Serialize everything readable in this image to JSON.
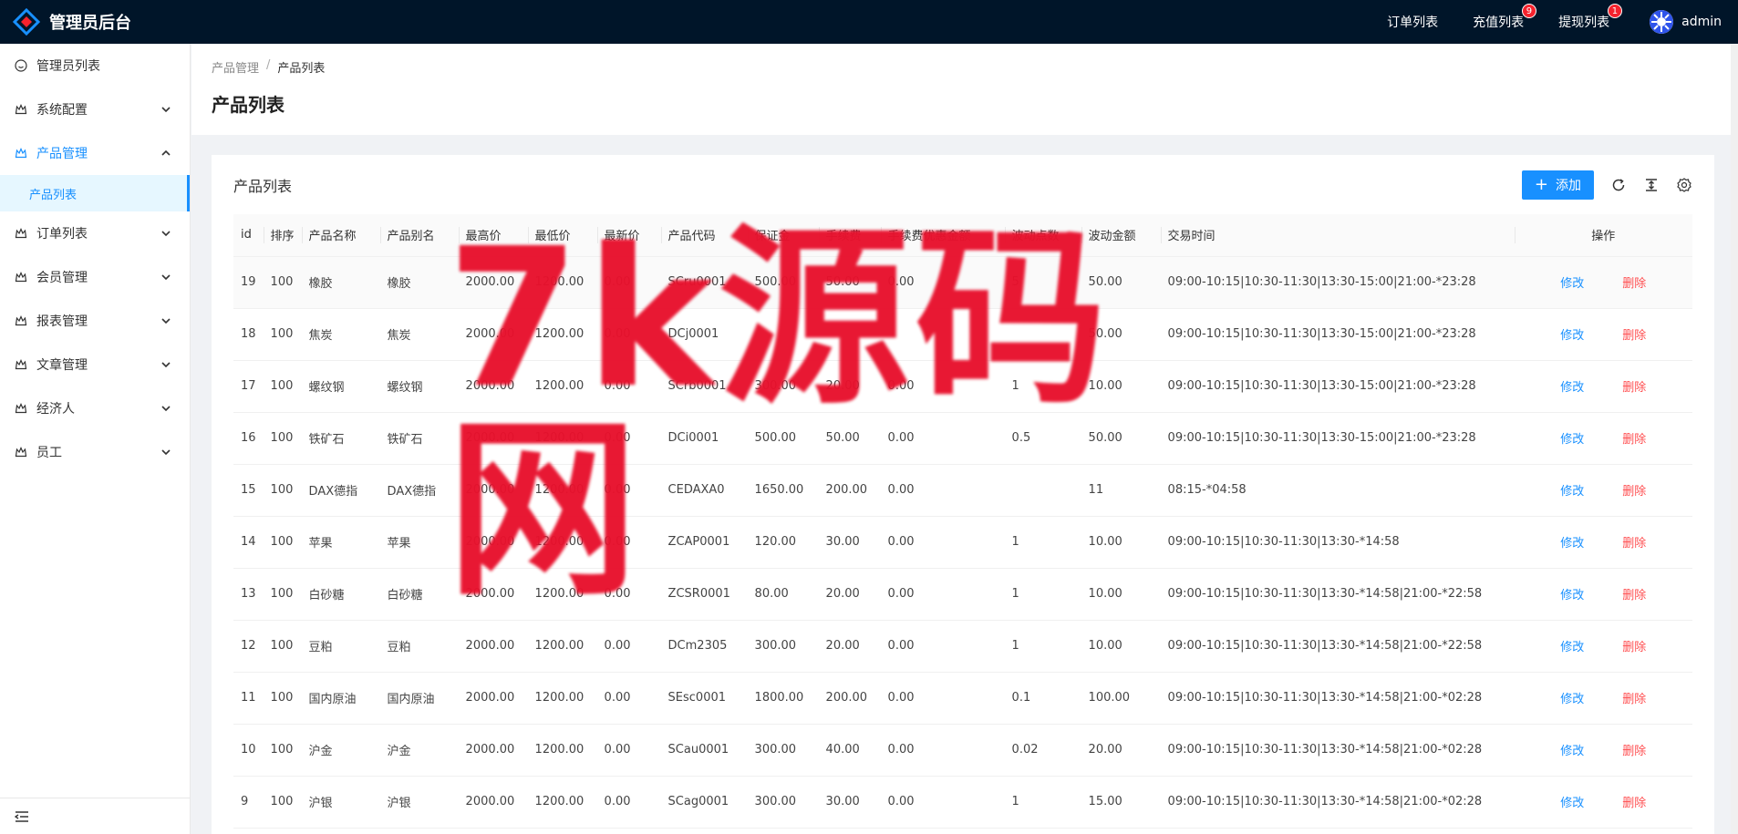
{
  "header": {
    "title": "管理员后台",
    "links": [
      {
        "label": "订单列表",
        "badge": ""
      },
      {
        "label": "充值列表",
        "badge": "9"
      },
      {
        "label": "提现列表",
        "badge": "1"
      }
    ],
    "user": "admin"
  },
  "sidebar": {
    "items": [
      {
        "label": "管理员列表",
        "icon": "smile-icon"
      },
      {
        "label": "系统配置",
        "icon": "crown-icon"
      },
      {
        "label": "产品管理",
        "icon": "crown-icon"
      },
      {
        "label": "订单列表",
        "icon": "crown-icon"
      },
      {
        "label": "会员管理",
        "icon": "crown-icon"
      },
      {
        "label": "报表管理",
        "icon": "crown-icon"
      },
      {
        "label": "文章管理",
        "icon": "crown-icon"
      },
      {
        "label": "经济人",
        "icon": "crown-icon"
      },
      {
        "label": "员工",
        "icon": "crown-icon"
      }
    ],
    "sub_item": "产品列表"
  },
  "breadcrumb": {
    "parent": "产品管理",
    "sep": "/",
    "current": "产品列表"
  },
  "page_title": "产品列表",
  "card": {
    "title": "产品列表",
    "add_label": "添加"
  },
  "table": {
    "columns": [
      "id",
      "排序",
      "产品名称",
      "产品别名",
      "最高价",
      "最低价",
      "最新价",
      "产品代码",
      "保证金",
      "手续费",
      "手续费优惠金额",
      "波动点数",
      "波动金额",
      "交易时间",
      "操作"
    ],
    "edit_label": "修改",
    "delete_label": "删除",
    "rows": [
      [
        "19",
        "100",
        "橡胶",
        "橡胶",
        "2000.00",
        "1200.00",
        "0.00",
        "SCru0001",
        "500.00",
        "50.00",
        "0.00",
        "5",
        "50.00",
        "09:00-10:15|10:30-11:30|13:30-15:00|21:00-*23:28"
      ],
      [
        "18",
        "100",
        "焦炭",
        "焦炭",
        "2000.00",
        "1200.00",
        "0.00",
        "DCj0001",
        "",
        "",
        "",
        "",
        "50.00",
        "09:00-10:15|10:30-11:30|13:30-15:00|21:00-*23:28"
      ],
      [
        "17",
        "100",
        "螺纹钢",
        "螺纹钢",
        "2000.00",
        "1200.00",
        "0.00",
        "SCrb0001",
        "300.00",
        "20.00",
        "0.00",
        "1",
        "10.00",
        "09:00-10:15|10:30-11:30|13:30-15:00|21:00-*23:28"
      ],
      [
        "16",
        "100",
        "铁矿石",
        "铁矿石",
        "2000.00",
        "1200.00",
        "0.00",
        "DCi0001",
        "500.00",
        "50.00",
        "0.00",
        "0.5",
        "50.00",
        "09:00-10:15|10:30-11:30|13:30-15:00|21:00-*23:28"
      ],
      [
        "15",
        "100",
        "DAX德指",
        "DAX德指",
        "2000.00",
        "1200.00",
        "0.00",
        "CEDAXA0",
        "1650.00",
        "200.00",
        "0.00",
        "",
        "11",
        "08:15-*04:58"
      ],
      [
        "14",
        "100",
        "苹果",
        "苹果",
        "2000.00",
        "1200.00",
        "0.00",
        "ZCAP0001",
        "120.00",
        "30.00",
        "0.00",
        "1",
        "10.00",
        "09:00-10:15|10:30-11:30|13:30-*14:58"
      ],
      [
        "13",
        "100",
        "白砂糖",
        "白砂糖",
        "2000.00",
        "1200.00",
        "0.00",
        "ZCSR0001",
        "80.00",
        "20.00",
        "0.00",
        "1",
        "10.00",
        "09:00-10:15|10:30-11:30|13:30-*14:58|21:00-*22:58"
      ],
      [
        "12",
        "100",
        "豆粕",
        "豆粕",
        "2000.00",
        "1200.00",
        "0.00",
        "DCm2305",
        "300.00",
        "20.00",
        "0.00",
        "1",
        "10.00",
        "09:00-10:15|10:30-11:30|13:30-*14:58|21:00-*22:58"
      ],
      [
        "11",
        "100",
        "国内原油",
        "国内原油",
        "2000.00",
        "1200.00",
        "0.00",
        "SEsc0001",
        "1800.00",
        "200.00",
        "0.00",
        "0.1",
        "100.00",
        "09:00-10:15|10:30-11:30|13:30-*14:58|21:00-*02:28"
      ],
      [
        "10",
        "100",
        "沪金",
        "沪金",
        "2000.00",
        "1200.00",
        "0.00",
        "SCau0001",
        "300.00",
        "40.00",
        "0.00",
        "0.02",
        "20.00",
        "09:00-10:15|10:30-11:30|13:30-*14:58|21:00-*02:28"
      ],
      [
        "9",
        "100",
        "沪银",
        "沪银",
        "2000.00",
        "1200.00",
        "0.00",
        "SCag0001",
        "300.00",
        "30.00",
        "0.00",
        "1",
        "15.00",
        "09:00-10:15|10:30-11:30|13:30-*14:58|21:00-*02:28"
      ]
    ]
  },
  "watermark": "7k源码网",
  "colors": {
    "header_bg": "#001529",
    "primary": "#1890ff",
    "danger": "#ff4d4f",
    "watermark": "#e8112d"
  }
}
